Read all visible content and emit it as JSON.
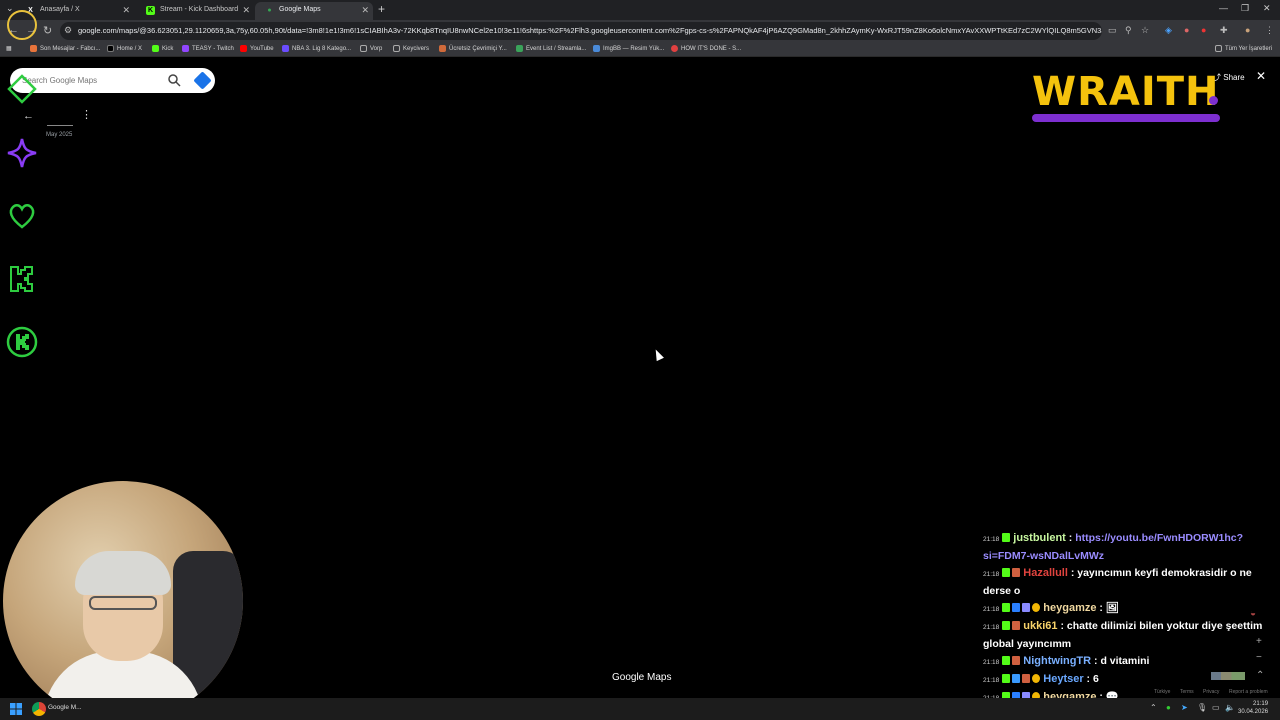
{
  "browser": {
    "tabs": [
      {
        "title": "Anasayfa / X",
        "fav": "X",
        "color": "#000000"
      },
      {
        "title": "Stream - Kick Dashboard",
        "fav": "K",
        "color": "#53fc18"
      },
      {
        "title": "Google Maps",
        "fav": "📍",
        "color": "#35363a"
      }
    ],
    "url": "google.com/maps/@36.623051,29.1120659,3a,75y,60.05h,90t/data=!3m8!1e1!3m6!1sCIABIhA3v-72KKqb8TnqIU8nwNCel2e10!3e11!6shttps:%2F%2Flh3.googleusercontent.com%2Fgps-cs-s%2FAPNQkAF4jP6AZQ9GMad8n_2khhZAymKy-WxRJT59nZ8Ko6olcNmxYAvXXWPTtKEd7zC2WYlQILQ8m5GVN3aAZ0nU73adE9qvlXUi5IJpDWs..."
  },
  "bookmarks": [
    {
      "label": "Son Mesajlar - Fabcı...",
      "color": "#e8743b"
    },
    {
      "label": "Home / X",
      "color": "#000000"
    },
    {
      "label": "Kick",
      "color": "#53fc18"
    },
    {
      "label": "TEASY - Twitch",
      "color": "#9146ff"
    },
    {
      "label": "YouTube",
      "color": "#ff0000"
    },
    {
      "label": "NBA 3. Lig 8 Katego...",
      "color": "#6a4cff"
    },
    {
      "label": "Vorp",
      "color": "#888888"
    },
    {
      "label": "Keycivers",
      "color": "#888888"
    },
    {
      "label": "Ücretsiz Çevrimiçi Y...",
      "color": "#d06a3a"
    },
    {
      "label": "Event List / Streamla...",
      "color": "#3aa35a"
    },
    {
      "label": "ImgBB — Resim Yük...",
      "color": "#4a8ad8"
    },
    {
      "label": "HOW IT'S DONE - S...",
      "color": "#e04040"
    }
  ],
  "bookmarks_right": "Tüm Yer İşaretleri",
  "maps": {
    "search_placeholder": "Search Google Maps",
    "date": "May 2025",
    "share": "Share",
    "logo": "Google Maps",
    "footer": [
      "Türkiye",
      "Terms",
      "Privacy",
      "Report a problem"
    ]
  },
  "overlay": {
    "brand": "WRAITH"
  },
  "chat": [
    {
      "time": "21:18",
      "user": "justbulent",
      "user_color": "#c8f7a0",
      "badges": [
        "#53fc18"
      ],
      "text": "https://youtu.be/FwnHDORW1hc?si=FDM7-wsNDalLvMWz",
      "is_link": true
    },
    {
      "time": "21:18",
      "user": "Hazallull",
      "user_color": "#e0433e",
      "badges": [
        "#53fc18",
        "#d06040"
      ],
      "text": "yayıncımın keyfi demokrasidir o ne derse o",
      "is_link": false
    },
    {
      "time": "21:18",
      "user": "heygamze",
      "user_color": "#f0d8a0",
      "badges": [
        "#53fc18",
        "#2a7fff",
        "#8a8aff",
        "#f2b705"
      ],
      "text": "🖼",
      "is_link": false
    },
    {
      "time": "21:18",
      "user": "ukki61",
      "user_color": "#f7d36a",
      "badges": [
        "#53fc18",
        "#d06040"
      ],
      "text": "chatte dilimizi bilen yoktur diye şeettim global yayıncımm",
      "is_link": false
    },
    {
      "time": "21:18",
      "user": "NightwingTR",
      "user_color": "#7ab0ff",
      "badges": [
        "#53fc18",
        "#d06040"
      ],
      "text": "d vitamini",
      "is_link": false
    },
    {
      "time": "21:18",
      "user": "Heytser",
      "user_color": "#6aa8ff",
      "badges": [
        "#53fc18",
        "#3a9aff",
        "#d06040",
        "#f2b705"
      ],
      "text": "6",
      "is_link": false
    },
    {
      "time": "21:18",
      "user": "heygamze",
      "user_color": "#f0d8a0",
      "badges": [
        "#53fc18",
        "#2a7fff",
        "#8a8aff",
        "#f2b705"
      ],
      "text": "💬",
      "is_link": false
    }
  ],
  "taskbar": {
    "app_label": "Google M...",
    "time": "21:19",
    "date": "30.04.2026"
  }
}
